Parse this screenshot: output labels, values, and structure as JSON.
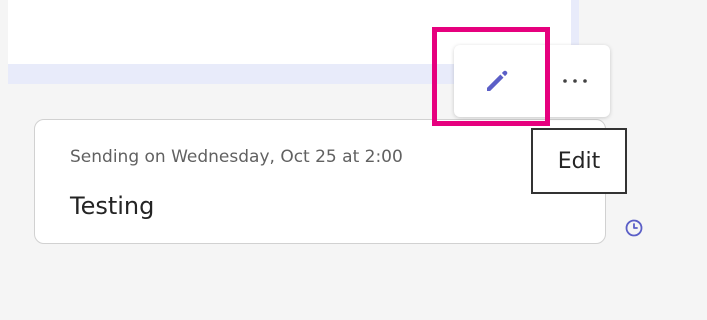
{
  "message": {
    "scheduled_text": "Sending on Wednesday, Oct 25 at 2:00",
    "body": "Testing"
  },
  "toolbar": {
    "edit_icon": "pencil-icon",
    "more_icon": "ellipsis-icon"
  },
  "tooltip": {
    "label": "Edit"
  },
  "status": {
    "icon": "clock-icon"
  },
  "colors": {
    "accent": "#5b5fc7",
    "highlight": "#e6007e",
    "lavender": "#e8ebfa"
  }
}
